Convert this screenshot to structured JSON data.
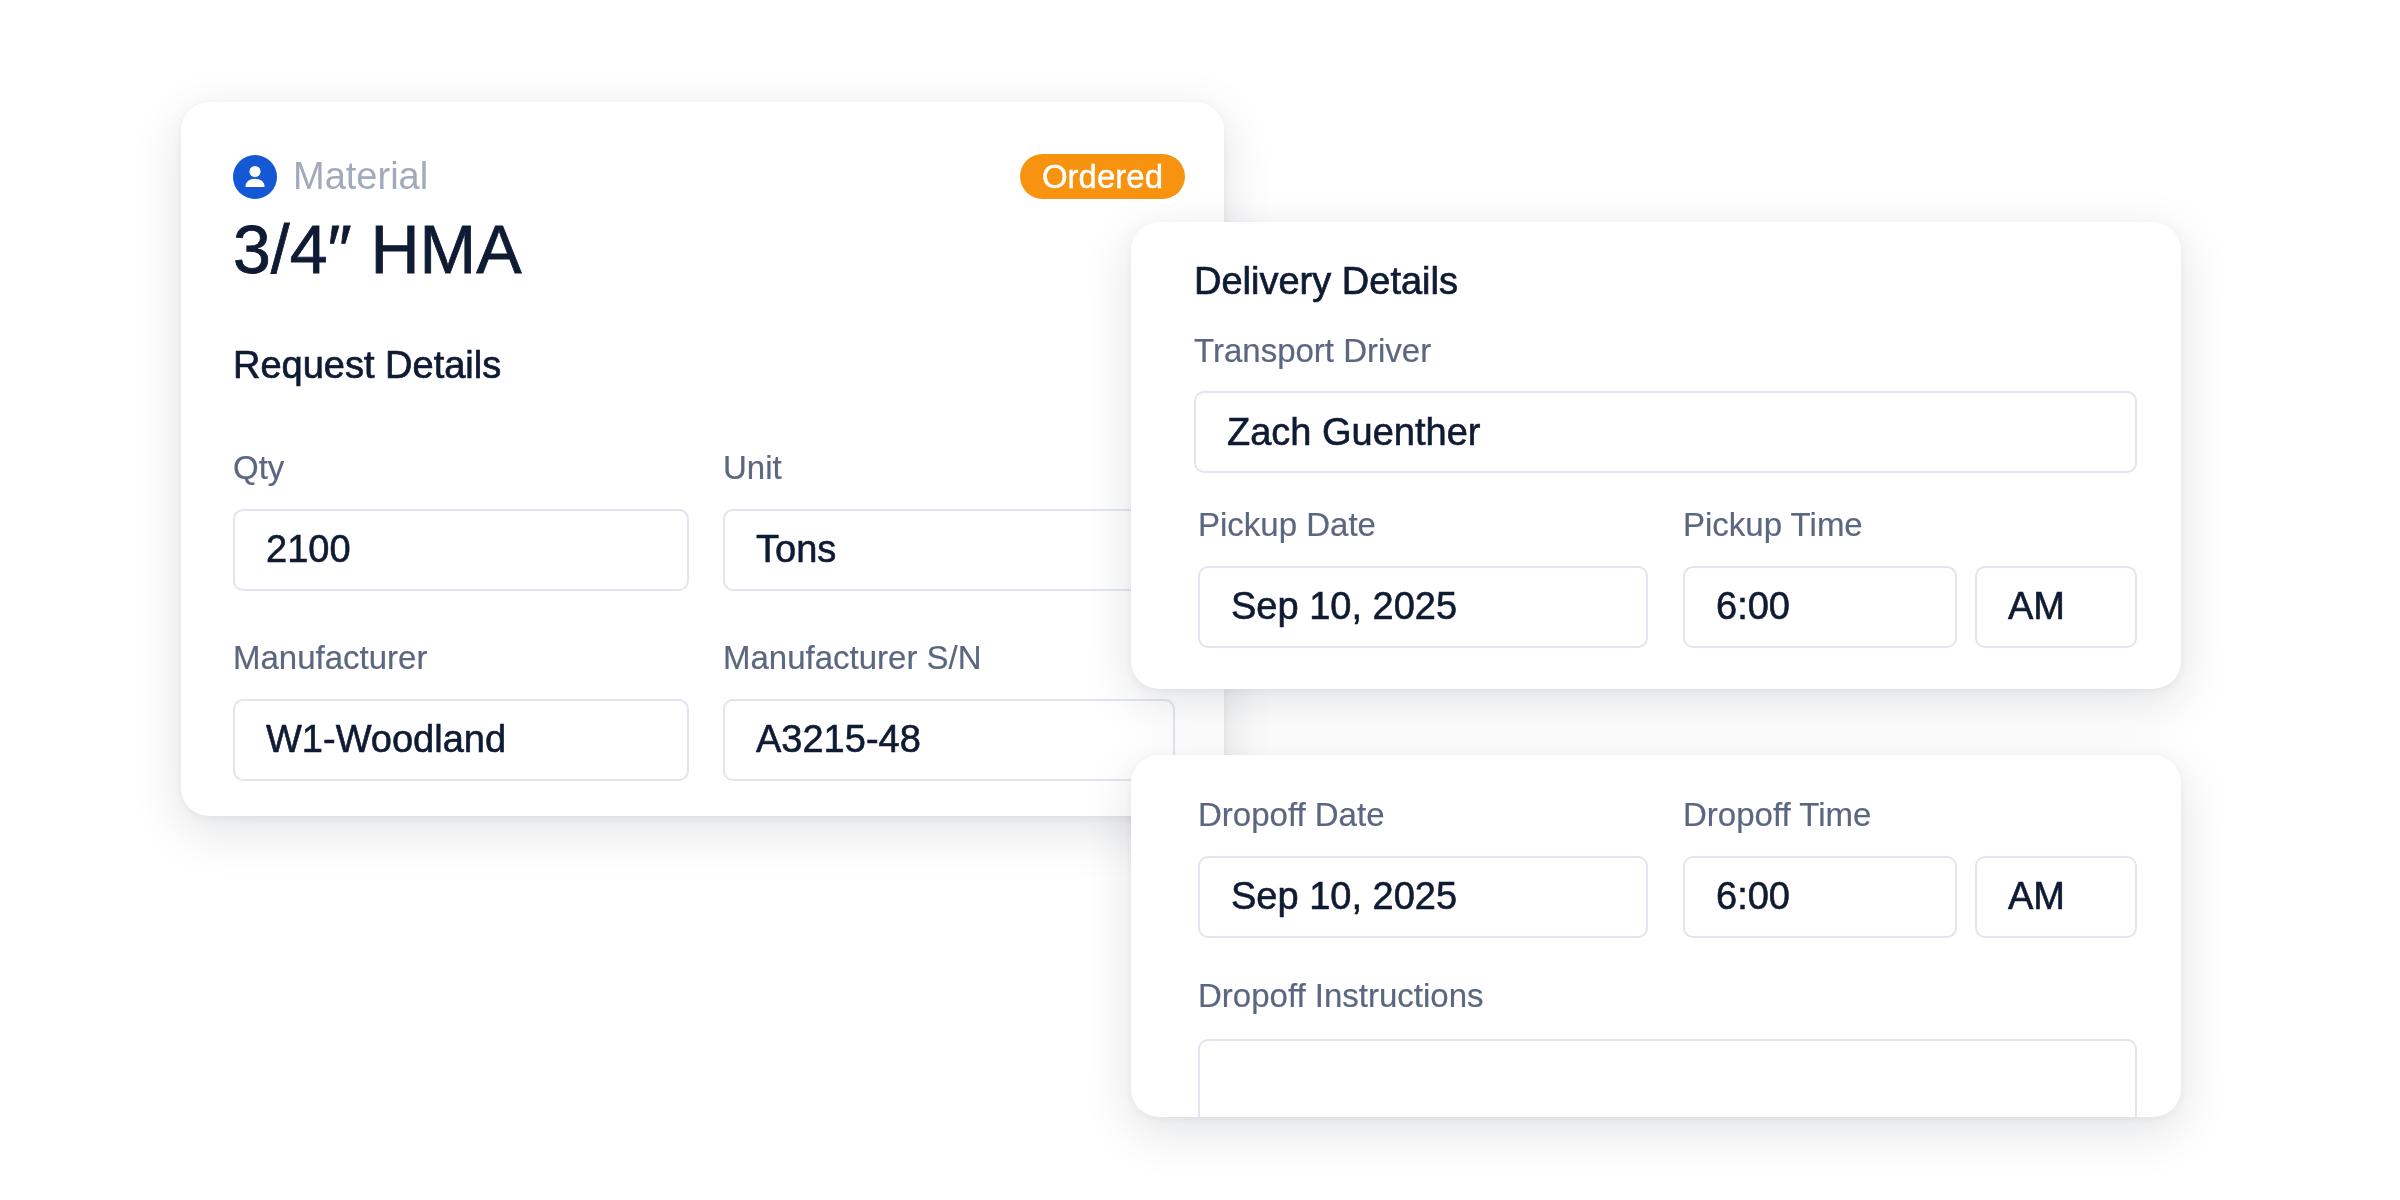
{
  "material_card": {
    "category": "Material",
    "status": "Ordered",
    "title": "3/4″ HMA",
    "section_title": "Request Details",
    "fields": [
      {
        "label": "Qty",
        "value": "2100"
      },
      {
        "label": "Unit",
        "value": "Tons"
      },
      {
        "label": "Manufacturer",
        "value": "W1-Woodland"
      },
      {
        "label": "Manufacturer S/N",
        "value": "A3215-48"
      }
    ]
  },
  "delivery_card": {
    "section_title": "Delivery Details",
    "driver": {
      "label": "Transport Driver",
      "value": "Zach Guenther"
    },
    "pickup": {
      "date_label": "Pickup Date",
      "date": "Sep 10, 2025",
      "time_label": "Pickup Time",
      "time": "6:00",
      "period": "AM"
    }
  },
  "dropoff_card": {
    "dropoff": {
      "date_label": "Dropoff Date",
      "date": "Sep 10, 2025",
      "time_label": "Dropoff Time",
      "time": "6:00",
      "period": "AM"
    },
    "instructions_label": "Dropoff Instructions"
  }
}
